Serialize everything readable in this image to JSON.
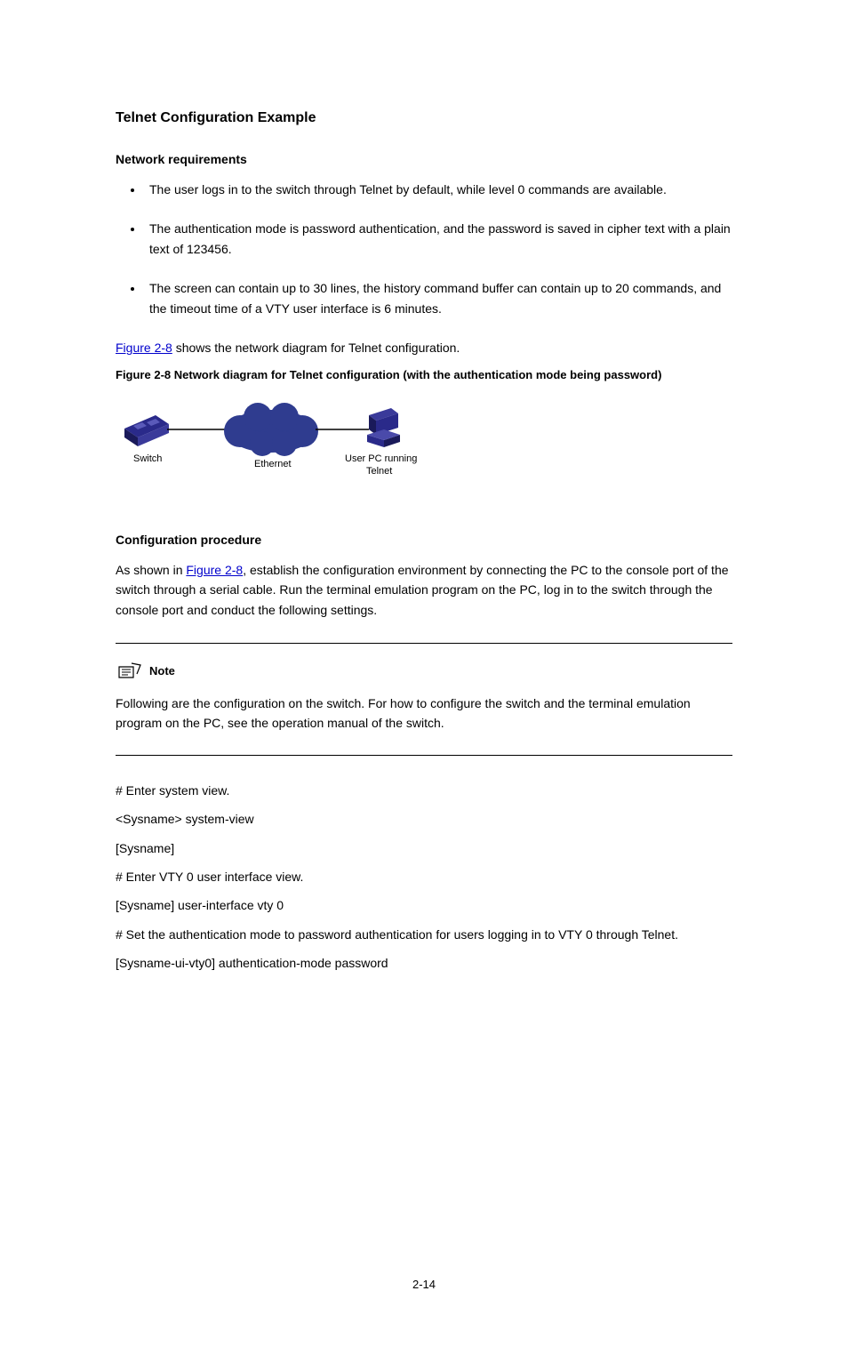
{
  "heading_main": "Telnet Configuration Example",
  "heading_network": "Network requirements",
  "bullets": [
    "The user logs in to the switch through Telnet by default, while level 0 commands are available. ",
    "The authentication mode is password authentication, and the password is saved in cipher text with a plain text of 123456. ",
    "The screen can contain up to 30 lines, the history command buffer can contain up to 20 commands, and the timeout time of a VTY user interface is 6 minutes. "
  ],
  "figure_link_text": "Figure 2-8",
  "figure_link_after": " shows the network diagram for Telnet configuration. ",
  "figure_caption_prefix": "Figure 2-8 ",
  "figure_caption_text": "Network diagram for Telnet configuration (with the authentication mode being password)",
  "diagram": {
    "switch_label": "Switch",
    "cloud_label": "Ethernet",
    "pc_label": "User PC running Telnet"
  },
  "heading_config": "Configuration procedure",
  "config_para_pre": "As shown in ",
  "config_para_link": "Figure 2-8",
  "config_para_post": ", establish the configuration environment by connecting the PC to the console port of the switch through a serial cable. Run the terminal emulation program on the PC, log in to the switch through the console port and conduct the following settings. ",
  "note_label": "Note",
  "note_body": "Following are the configuration on the switch. For how to configure the switch and the terminal emulation program on the PC, see the operation manual of the switch. ",
  "step1": "# Enter system view. ",
  "cmd1a": "<Sysname> system-view ",
  "cmd1b": "[Sysname]",
  "step2": "# Enter VTY 0 user interface view. ",
  "cmd2": "[Sysname] user-interface vty 0 ",
  "step3": "# Set the authentication mode to password authentication for users logging in to VTY 0 through Telnet. ",
  "cmd3": "[Sysname-ui-vty0] authentication-mode password ",
  "page_number": "2-14"
}
